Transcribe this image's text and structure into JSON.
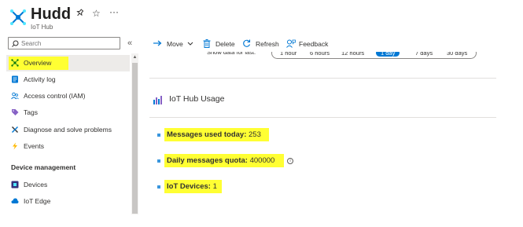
{
  "header": {
    "title": "Hudd",
    "subtitle": "IoT Hub",
    "pin_icon": "pin-icon",
    "star_icon": "star-icon",
    "more_icon": "more-icon"
  },
  "search": {
    "placeholder": "Search"
  },
  "sidebar": {
    "items": [
      {
        "label": "Overview",
        "icon": "overview-icon",
        "active": true
      },
      {
        "label": "Activity log",
        "icon": "activity-log-icon"
      },
      {
        "label": "Access control (IAM)",
        "icon": "people-icon"
      },
      {
        "label": "Tags",
        "icon": "tag-icon"
      },
      {
        "label": "Diagnose and solve problems",
        "icon": "wrench-icon"
      },
      {
        "label": "Events",
        "icon": "lightning-icon"
      }
    ],
    "section_heading": "Device management",
    "section_items": [
      {
        "label": "Devices",
        "icon": "devices-icon"
      },
      {
        "label": "IoT Edge",
        "icon": "cloud-icon"
      }
    ]
  },
  "toolbar": {
    "move_label": "Move",
    "delete_label": "Delete",
    "refresh_label": "Refresh",
    "feedback_label": "Feedback"
  },
  "time_filter": {
    "label": "Show data for last:",
    "options": [
      "1 hour",
      "6 hours",
      "12 hours",
      "1 day",
      "7 days",
      "30 days"
    ],
    "selected": "1 day"
  },
  "usage_tile": {
    "title": "IoT Hub Usage",
    "metrics": [
      {
        "label": "Messages used today:",
        "value": "253"
      },
      {
        "label": "Daily messages quota:",
        "value": "400000"
      },
      {
        "label": "IoT Devices:",
        "value": "1"
      }
    ]
  },
  "colors": {
    "accent": "#0078d4",
    "highlight": "#ffff33",
    "bullet": "#3a96dd"
  }
}
